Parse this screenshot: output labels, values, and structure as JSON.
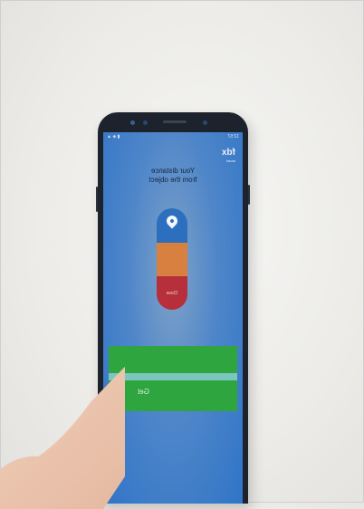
{
  "screen": {
    "statusbar": {
      "time": "12:57",
      "icons": "▮ ◈ ▲"
    },
    "logo": {
      "main": "fdx",
      "sub": "smart"
    },
    "headline": [
      "Your distance",
      "from the object"
    ],
    "indicator": {
      "bottom_label": "Close"
    },
    "button": {
      "label": "Get"
    }
  },
  "colors": {
    "screen_blue": "#2f74c7",
    "indicator_blue": "#2b6fbe",
    "indicator_orange": "#d8803f",
    "indicator_red": "#b62f3b",
    "button_green": "#2ea53f"
  }
}
